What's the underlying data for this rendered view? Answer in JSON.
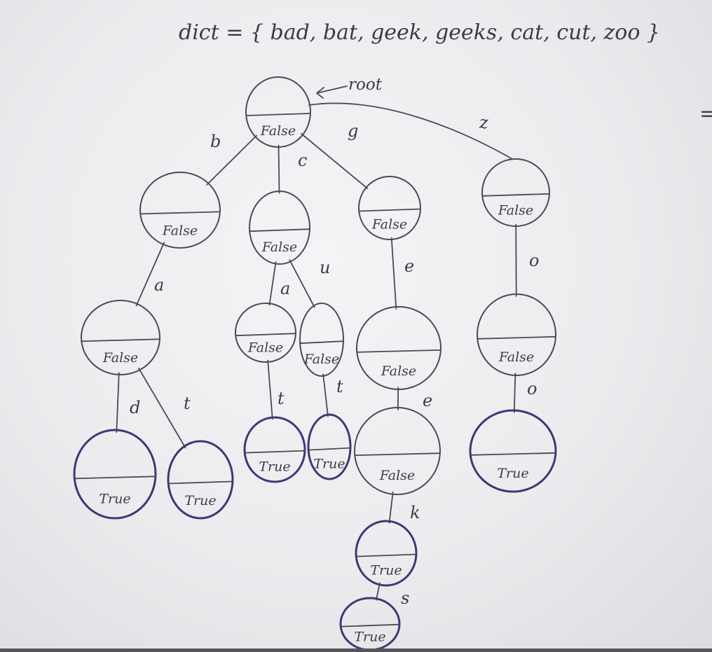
{
  "title": "dict = { bad, bat, geek, geeks, cat, cut, zoo }",
  "root_label": "root",
  "stray_mark": "=",
  "nodes": [
    {
      "id": "root",
      "value": "False",
      "terminal": false
    },
    {
      "id": "b",
      "value": "False",
      "terminal": false
    },
    {
      "id": "c",
      "value": "False",
      "terminal": false
    },
    {
      "id": "g",
      "value": "False",
      "terminal": false
    },
    {
      "id": "z",
      "value": "False",
      "terminal": false
    },
    {
      "id": "ba",
      "value": "False",
      "terminal": false
    },
    {
      "id": "ca",
      "value": "False",
      "terminal": false
    },
    {
      "id": "cu",
      "value": "False",
      "terminal": false
    },
    {
      "id": "ge",
      "value": "False",
      "terminal": false
    },
    {
      "id": "zo",
      "value": "False",
      "terminal": false
    },
    {
      "id": "bad",
      "value": "True",
      "terminal": true
    },
    {
      "id": "bat",
      "value": "True",
      "terminal": true
    },
    {
      "id": "cat",
      "value": "True",
      "terminal": true
    },
    {
      "id": "cut",
      "value": "True",
      "terminal": true
    },
    {
      "id": "gee",
      "value": "False",
      "terminal": false
    },
    {
      "id": "zoo",
      "value": "True",
      "terminal": true
    },
    {
      "id": "geek",
      "value": "True",
      "terminal": true
    },
    {
      "id": "geeks",
      "value": "True",
      "terminal": true
    }
  ],
  "edges": [
    {
      "from": "root",
      "to": "b",
      "label": "b"
    },
    {
      "from": "root",
      "to": "c",
      "label": "c"
    },
    {
      "from": "root",
      "to": "g",
      "label": "g"
    },
    {
      "from": "root",
      "to": "z",
      "label": "z"
    },
    {
      "from": "b",
      "to": "ba",
      "label": "a"
    },
    {
      "from": "c",
      "to": "ca",
      "label": "a"
    },
    {
      "from": "c",
      "to": "cu",
      "label": "u"
    },
    {
      "from": "g",
      "to": "ge",
      "label": "e"
    },
    {
      "from": "z",
      "to": "zo",
      "label": "o"
    },
    {
      "from": "ba",
      "to": "bad",
      "label": "d"
    },
    {
      "from": "ba",
      "to": "bat",
      "label": "t"
    },
    {
      "from": "ca",
      "to": "cat",
      "label": "t"
    },
    {
      "from": "cu",
      "to": "cut",
      "label": "t"
    },
    {
      "from": "ge",
      "to": "gee",
      "label": "e"
    },
    {
      "from": "zo",
      "to": "zoo",
      "label": "o"
    },
    {
      "from": "gee",
      "to": "geek",
      "label": "k"
    },
    {
      "from": "geek",
      "to": "geeks",
      "label": "s"
    }
  ]
}
